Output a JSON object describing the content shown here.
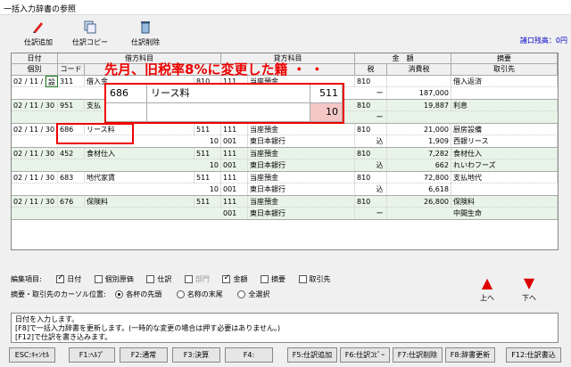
{
  "window": {
    "title": "一括入力辞書の参照"
  },
  "toolbar": {
    "add_label": "仕訳追加",
    "copy_label": "仕訳コピー",
    "delete_label": "仕訳削除"
  },
  "balance_label": "諸口残高：0円",
  "notice": "先月、旧税率8%に変更した籍 ・ ・",
  "grid": {
    "header_top": [
      "日付",
      "借方科目",
      "貸方科目",
      "金　額",
      "摘要"
    ],
    "header_bottom": [
      "個別",
      "コード",
      "税",
      "消費税",
      "取引先"
    ],
    "rows": [
      {
        "date": "02 / 11 / ",
        "flag": "設",
        "d_code": "311",
        "d_name": "借入金",
        "d_sub": "810",
        "c_code": "111",
        "c_name": "当座預金",
        "tax": "810",
        "amount": "",
        "tax_mark": "",
        "memo": "借入返済",
        "l2_d": "",
        "l2_c_code": "",
        "l2_c_name": "",
        "l2_tax_mark": "ー",
        "l2_amount": "187,000",
        "l2_memo": ""
      },
      {
        "date": "02 / 11 / 30",
        "flag": "",
        "d_code": "951",
        "d_name": "支払",
        "d_sub": "",
        "c_code": "",
        "c_name": "",
        "tax": "810",
        "amount": "19,887",
        "tax_mark": "",
        "memo": "利息",
        "l2_d": "",
        "l2_c_code": "",
        "l2_c_name": "",
        "l2_tax_mark": "ー",
        "l2_amount": "",
        "l2_memo": ""
      },
      {
        "date": "02 / 11 / 30",
        "flag": "",
        "d_code": "686",
        "d_name": "リース料",
        "d_sub": "511",
        "c_code": "111",
        "c_name": "当座預金",
        "tax": "810",
        "amount": "21,000",
        "tax_mark": "",
        "memo": "厨房設備",
        "l2_d": "10",
        "l2_c_code": "001",
        "l2_c_name": "東日本銀行",
        "l2_tax_mark": "込",
        "l2_amount": "1,909",
        "l2_memo": "西銀リース"
      },
      {
        "date": "02 / 11 / 30",
        "flag": "",
        "d_code": "452",
        "d_name": "食材仕入",
        "d_sub": "511",
        "c_code": "111",
        "c_name": "当座預金",
        "tax": "810",
        "amount": "7,282",
        "tax_mark": "",
        "memo": "食材仕入",
        "l2_d": "10",
        "l2_c_code": "001",
        "l2_c_name": "東日本銀行",
        "l2_tax_mark": "込",
        "l2_amount": "662",
        "l2_memo": "れいわフーズ"
      },
      {
        "date": "02 / 11 / 30",
        "flag": "",
        "d_code": "683",
        "d_name": "地代家賃",
        "d_sub": "511",
        "c_code": "111",
        "c_name": "当座預金",
        "tax": "810",
        "amount": "72,800",
        "tax_mark": "",
        "memo": "支払地代",
        "l2_d": "10",
        "l2_c_code": "001",
        "l2_c_name": "東日本銀行",
        "l2_tax_mark": "込",
        "l2_amount": "6,618",
        "l2_memo": ""
      },
      {
        "date": "02 / 11 / 30",
        "flag": "",
        "d_code": "676",
        "d_name": "保険料",
        "d_sub": "511",
        "c_code": "111",
        "c_name": "当座預金",
        "tax": "810",
        "amount": "26,800",
        "tax_mark": "",
        "memo": "保険料",
        "l2_d": "",
        "l2_c_code": "001",
        "l2_c_name": "東日本銀行",
        "l2_tax_mark": "ー",
        "l2_amount": "",
        "l2_memo": "中間生命"
      }
    ]
  },
  "overlay": {
    "code": "686",
    "name": "リース料",
    "sub": "511",
    "rate": "10"
  },
  "options": {
    "edit_label": "編集項目:",
    "date": "日付",
    "individual": "個別原価",
    "journal": "仕訳",
    "dept": "部門",
    "amount": "金額",
    "summary": "摘要",
    "partner": "取引先",
    "cursor_label": "摘要・取引先のカーソル位置:",
    "cursor_head": "各杯の先頭",
    "cursor_tail": "名称の末尾",
    "cursor_all": "全選択"
  },
  "move": {
    "up": "上へ",
    "down": "下へ"
  },
  "messages": [
    "日付を入力します。",
    "[F8]で一括入力辞書を更新します。(一時的な変更の場合は押す必要はありません。)",
    "[F12]で仕訳を書き込みます。"
  ],
  "fkeys": [
    "ESC:ｷｬﾝｾﾙ",
    "F1:ﾍﾙﾌﾟ",
    "F2:通常",
    "F3:決算",
    "F4:",
    "F5:仕訳追加",
    "F6:仕訳ｺﾋﾟｰ",
    "F7:仕訳削除",
    "F8:辞書更新",
    "F12:仕訳書込"
  ],
  "colors": {
    "accent_red": "#e00000",
    "row_alt": "#e8f4e8",
    "link_blue": "#0000cc"
  }
}
